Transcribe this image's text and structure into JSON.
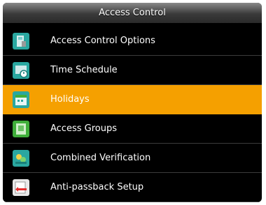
{
  "title": "Access Control",
  "menu": {
    "items": [
      {
        "label": "Access Control Options",
        "icon": "access-options-icon",
        "selected": false
      },
      {
        "label": "Time Schedule",
        "icon": "time-schedule-icon",
        "selected": false
      },
      {
        "label": "Holidays",
        "icon": "holidays-icon",
        "selected": true
      },
      {
        "label": "Access Groups",
        "icon": "access-groups-icon",
        "selected": false
      },
      {
        "label": "Combined Verification",
        "icon": "combined-verification-icon",
        "selected": false
      },
      {
        "label": "Anti-passback Setup",
        "icon": "anti-passback-icon",
        "selected": false
      }
    ]
  },
  "colors": {
    "background": "#000000",
    "selected_row": "#f5a000",
    "icon_teal": "#2aa7a0",
    "icon_green": "#3fae3a"
  }
}
